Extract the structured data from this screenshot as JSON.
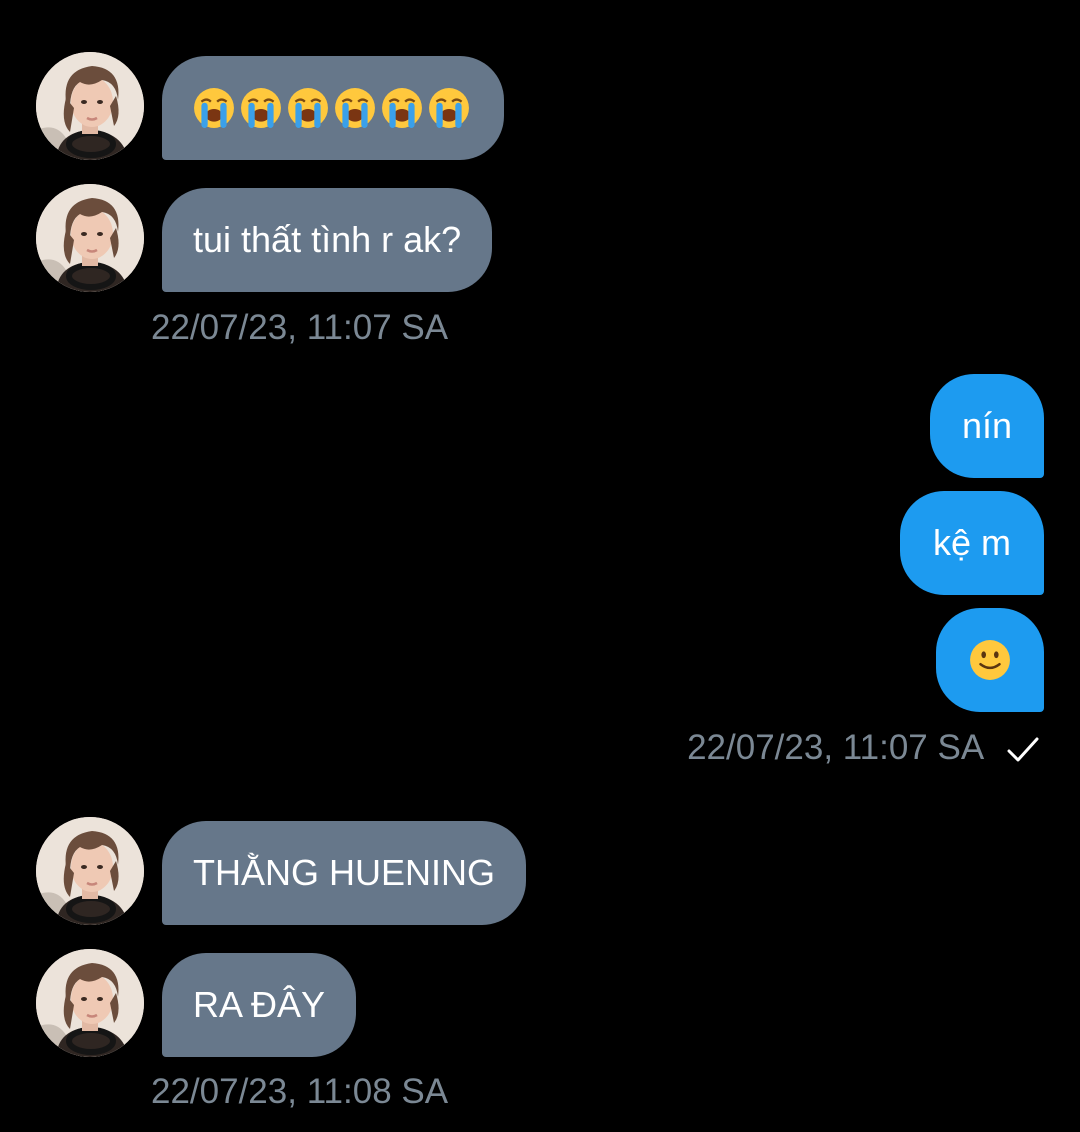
{
  "incoming_group_1": {
    "emoji_message": {
      "emoji_name": "loudly-crying-face",
      "count": 6
    },
    "text_message": "tui thất tình r ak?",
    "timestamp": "22/07/23, 11:07 SA"
  },
  "outgoing_group": {
    "messages": [
      "nín",
      "kệ m"
    ],
    "emoji_message": {
      "emoji_name": "slightly-smiling-face"
    },
    "timestamp": "22/07/23, 11:07 SA",
    "status_icon": "checkmark-icon"
  },
  "incoming_group_2": {
    "messages": [
      "THẰNG HUENING",
      "RA ĐÂY"
    ],
    "timestamp": "22/07/23, 11:08 SA"
  },
  "colors": {
    "background": "#000000",
    "incoming_bubble": "#66778a",
    "outgoing_bubble": "#1d9bf0",
    "timestamp_text": "#7b8894",
    "message_text": "#ffffff"
  }
}
